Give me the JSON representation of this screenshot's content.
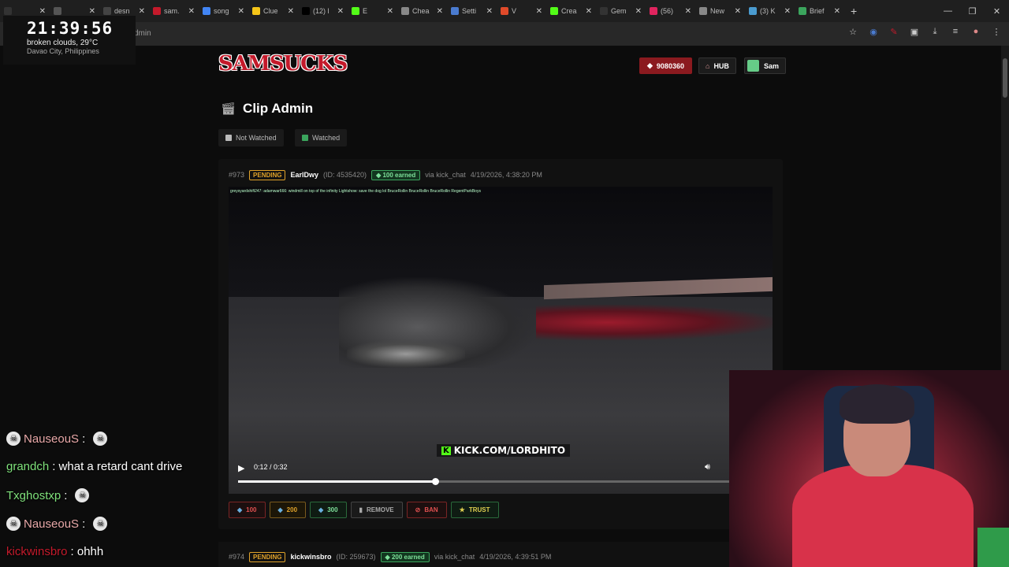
{
  "browser": {
    "tabs": [
      {
        "label": "",
        "color": "#333"
      },
      {
        "label": "",
        "color": "#555"
      },
      {
        "label": "desn",
        "color": "#444"
      },
      {
        "label": "sam.",
        "color": "#c41a2b"
      },
      {
        "label": "song",
        "color": "#4285f4"
      },
      {
        "label": "Clue",
        "color": "#f5c518"
      },
      {
        "label": "(12) l",
        "color": "#000"
      },
      {
        "label": "E",
        "color": "#53fc18"
      },
      {
        "label": "Chea",
        "color": "#888"
      },
      {
        "label": "Setti",
        "color": "#4a7bd0"
      },
      {
        "label": "V",
        "color": "#e04a2a"
      },
      {
        "label": "Crea",
        "color": "#53fc18"
      },
      {
        "label": "Gem",
        "color": "#333"
      },
      {
        "label": "(56)",
        "color": "#e0245e"
      },
      {
        "label": "New",
        "color": "#888"
      },
      {
        "label": "(3) K",
        "color": "#4a9bd0"
      },
      {
        "label": "Brief",
        "color": "#3ba55d"
      }
    ],
    "url": "dmin"
  },
  "clock": {
    "time": "21:39:56",
    "weather": "broken clouds, 29°C",
    "location": "Davao City, Philippines"
  },
  "header": {
    "logo_text": "SAMSUCKS",
    "points": "9080360",
    "hub_label": "HUB",
    "user_name": "Sam"
  },
  "page": {
    "title": "Clip Admin",
    "filters": [
      {
        "label": "Not Watched",
        "color": "#bbbbbb"
      },
      {
        "label": "Watched",
        "color": "#3ba55d"
      }
    ]
  },
  "clips": [
    {
      "number": "#973",
      "status": "PENDING",
      "username": "EarlDwy",
      "user_id": "(ID: 4535420)",
      "earned": "100 earned",
      "via": "via kick_chat",
      "date": "4/19/2026, 4:38:20 PM",
      "video": {
        "chat_strip": "greysyardshift247: adamwar666: windmill on top of the infinity   Lightshow: save the dog lol   BruceRollin   BruceRollin   BruceRollin   RegentParkBoys",
        "watermark": "KICK.COM/LORDHITO",
        "time_display": "0:12 / 0:32",
        "progress": 0.375
      },
      "actions": [
        "100",
        "200",
        "300",
        "REMOVE",
        "BAN",
        "TRUST"
      ]
    },
    {
      "number": "#974",
      "status": "PENDING",
      "username": "kickwinsbro",
      "user_id": "(ID: 259673)",
      "earned": "200 earned",
      "via": "via kick_chat",
      "date": "4/19/2026, 4:39:51 PM"
    }
  ],
  "chat": [
    {
      "user": "NauseouS",
      "message": ":",
      "user_color": "#e8a8a8",
      "emote": true,
      "prefix_emote": true
    },
    {
      "user": "grandch",
      "message": ": what a retard cant drive",
      "user_color": "#7ee07a",
      "emote": false,
      "prefix_emote": false
    },
    {
      "user": "Txghostxp",
      "message": ":",
      "user_color": "#7ee07a",
      "emote": true,
      "prefix_emote": false
    },
    {
      "user": "NauseouS",
      "message": ":",
      "user_color": "#e8a8a8",
      "emote": true,
      "prefix_emote": true
    },
    {
      "user": "kickwinsbro",
      "message": ": ohhh",
      "user_color": "#c41a2b",
      "emote": false,
      "prefix_emote": false
    }
  ]
}
